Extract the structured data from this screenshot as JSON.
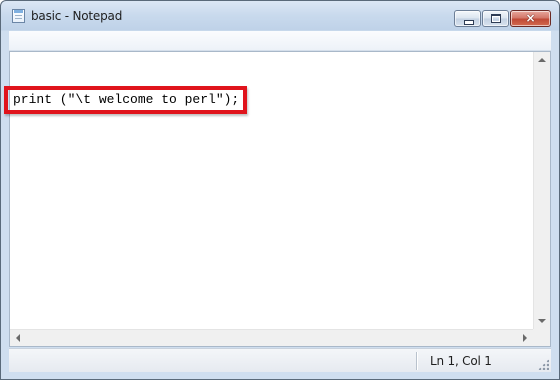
{
  "window": {
    "title": "basic - Notepad",
    "icon": "notepad-icon"
  },
  "controls": {
    "minimize": "minimize-icon",
    "maximize": "maximize-icon",
    "close": "×"
  },
  "editor": {
    "content": "print (\"\\t welcome to perl\");",
    "highlight_color": "#e0141c"
  },
  "statusbar": {
    "position": "Ln 1, Col 1"
  },
  "colors": {
    "accent": "#c04a37",
    "chrome": "#c9daed"
  }
}
